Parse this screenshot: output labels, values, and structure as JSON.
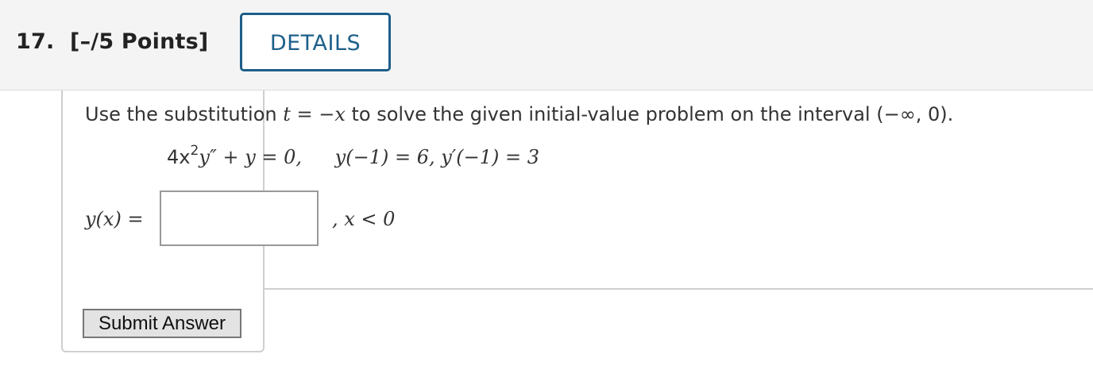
{
  "question": {
    "number_label": "17.",
    "points_label": "[–/5 Points]",
    "details_label": "DETAILS"
  },
  "problem": {
    "prompt_prefix": "Use the substitution ",
    "substitution": "t = −x",
    "prompt_suffix": " to solve the given initial-value problem on the interval (−∞, 0).",
    "equation_lhs_coeff": "4x",
    "equation_power": "2",
    "equation_rest": "y″ + y = 0,",
    "initial_conditions": "y(−1) = 6, y′(−1) = 3"
  },
  "answer": {
    "label": "y(x) =",
    "value": "",
    "domain": ", x < 0"
  },
  "actions": {
    "submit_label": "Submit Answer"
  }
}
